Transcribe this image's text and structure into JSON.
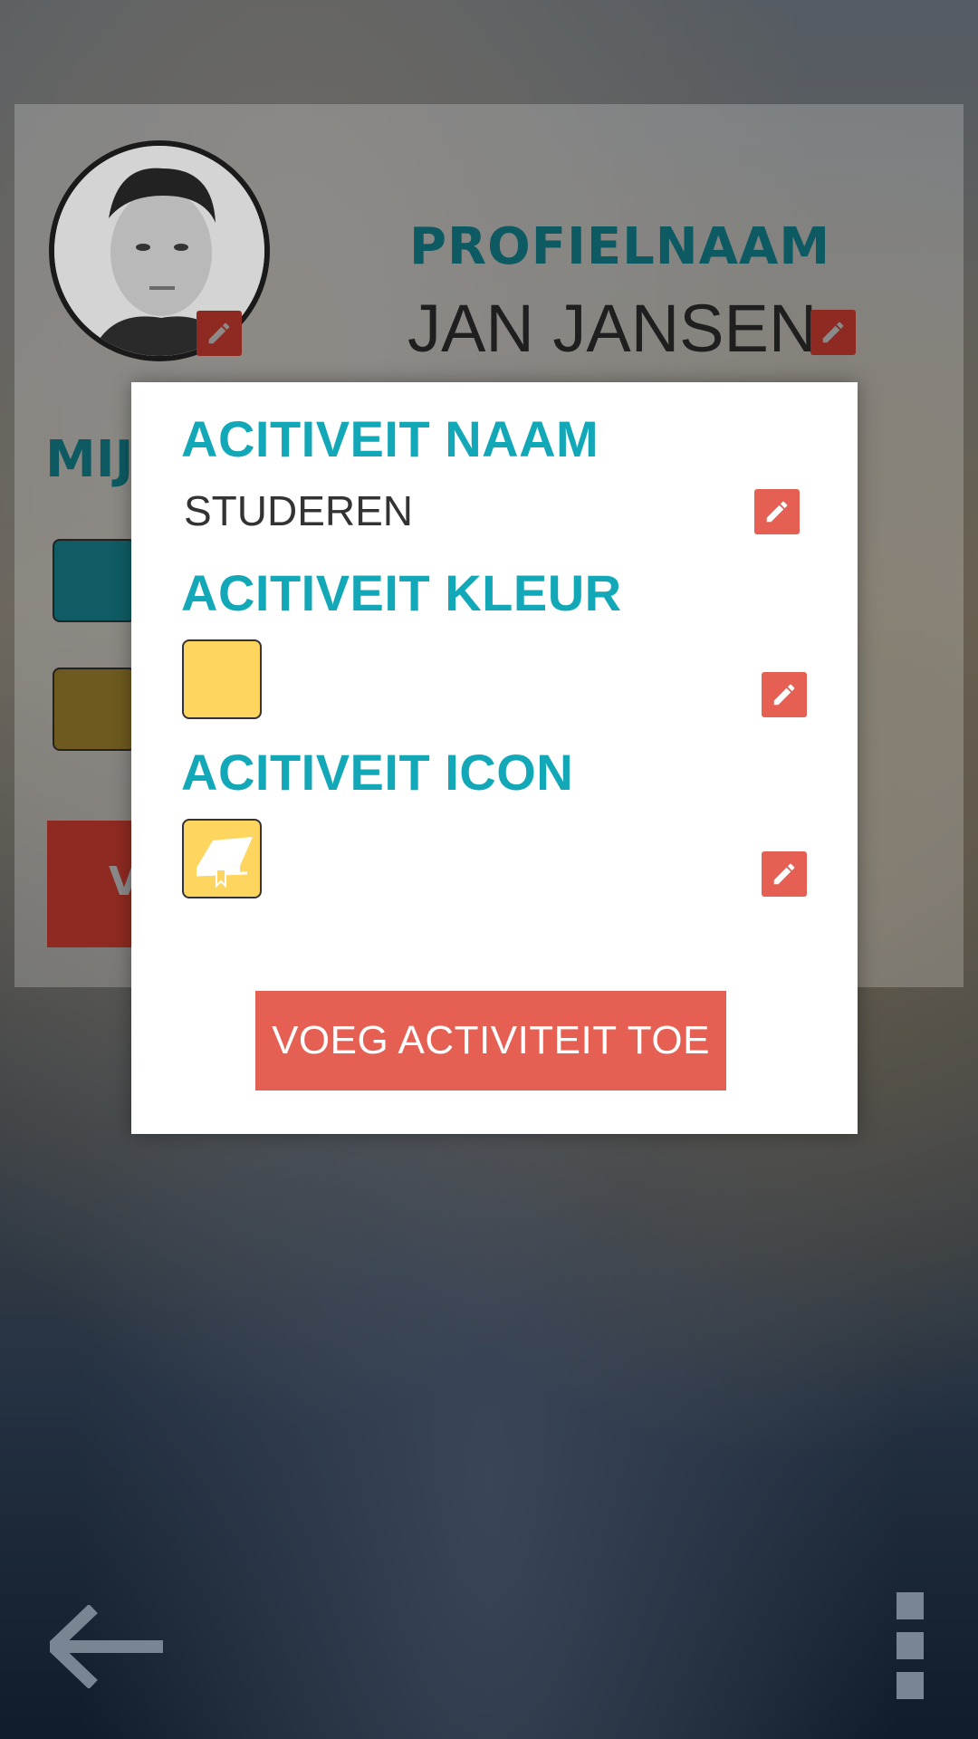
{
  "profile": {
    "label": "PROFIELNAAM",
    "name": "JAN JANSEN",
    "section_heading_partial": "MIJ",
    "button_partial": "V"
  },
  "modal": {
    "name_heading": "ACITIVEIT NAAM",
    "name_value": "STUDEREN",
    "color_heading": "ACITIVEIT KLEUR",
    "color_value": "#fdd55f",
    "icon_heading": "ACITIVEIT ICON",
    "icon_name": "book-icon",
    "submit_label": "VOEG ACTIVITEIT TOE"
  },
  "colors": {
    "accent_teal": "#13a8b7",
    "accent_red": "#e55f52",
    "selected_yellow": "#fdd55f"
  },
  "nav": {
    "back_icon": "arrow-left-icon",
    "menu_icon": "overflow-menu-icon"
  }
}
